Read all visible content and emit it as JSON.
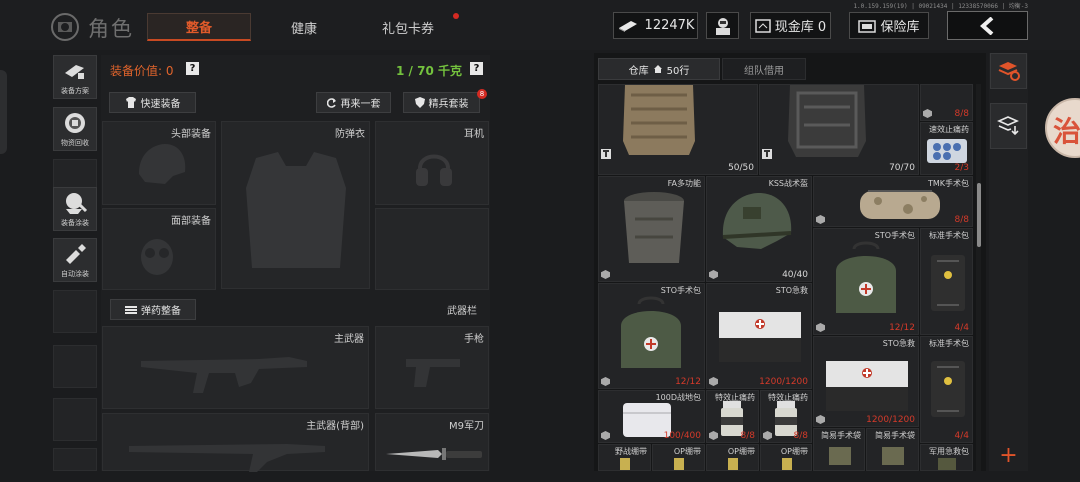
{
  "header": {
    "version": "1.0.159.159(19) | 09021434 | 12338570066 | 均衡-3",
    "title": "角色",
    "tabs": [
      {
        "label": "整备",
        "active": true
      },
      {
        "label": "健康",
        "active": false
      },
      {
        "label": "礼包卡券",
        "active": false,
        "dot": true
      }
    ],
    "currency": "12247K",
    "cash_vault": "现金库 0",
    "safe_vault": "保险库"
  },
  "left_rail": [
    {
      "label": "装备方案",
      "icon": "loadout-icon"
    },
    {
      "label": "物资回收",
      "icon": "recycle-icon"
    },
    {
      "label": "装备涂装",
      "icon": "skin-icon"
    },
    {
      "label": "自动涂装",
      "icon": "auto-paint-icon"
    }
  ],
  "equipment": {
    "value_label": "装备价值: 0",
    "help": "?",
    "weight": "1 / 70 千克",
    "quick_equip": "快速装备",
    "again": "再来一套",
    "elite": "精兵套装",
    "elite_badge": "8",
    "slots": {
      "head": "头部装备",
      "armor": "防弹衣",
      "ear": "耳机",
      "face": "面部装备",
      "primary": "主武器",
      "pistol": "手枪",
      "back": "主武器(背部)",
      "knife": "M9军刀"
    },
    "ammo_btn": "弹药整备",
    "weapon_bar": "武器栏"
  },
  "storage": {
    "tab_warehouse": "仓库",
    "rows": "50行",
    "tab_team": "组队借用",
    "items": [
      {
        "name": "",
        "count": "50/50",
        "count_color": "white"
      },
      {
        "name": "",
        "count": "70/70",
        "count_color": "white"
      },
      {
        "name": "",
        "count": "8/8",
        "count_color": "red"
      },
      {
        "name": "速效止痛药",
        "count": "2/3",
        "count_color": "red"
      },
      {
        "name": "FA多功能",
        "count": "",
        "count_color": "red"
      },
      {
        "name": "KSS战术盔",
        "count": "40/40",
        "count_color": "white"
      },
      {
        "name": "TMK手术包",
        "count": "8/8",
        "count_color": "red"
      },
      {
        "name": "STO手术包",
        "count": "12/12",
        "count_color": "red"
      },
      {
        "name": "标准手术包",
        "count": "4/4",
        "count_color": "red"
      },
      {
        "name": "STO手术包",
        "count": "12/12",
        "count_color": "red"
      },
      {
        "name": "STO急救",
        "count": "1200/1200",
        "count_color": "red"
      },
      {
        "name": "STO急救",
        "count": "1200/1200",
        "count_color": "red"
      },
      {
        "name": "标准手术包",
        "count": "4/4",
        "count_color": "red"
      },
      {
        "name": "100D战地包",
        "count": "100/400",
        "count_color": "red"
      },
      {
        "name": "特效止痛药",
        "count": "8/8",
        "count_color": "red"
      },
      {
        "name": "特效止痛药",
        "count": "8/8",
        "count_color": "red"
      },
      {
        "name": "野战绷带",
        "count": "",
        "count_color": "red"
      },
      {
        "name": "OP绷带",
        "count": "",
        "count_color": "red"
      },
      {
        "name": "OP绷带",
        "count": "",
        "count_color": "red"
      },
      {
        "name": "OP绷带",
        "count": "",
        "count_color": "red"
      },
      {
        "name": "简易手术袋",
        "count": "",
        "count_color": "red"
      },
      {
        "name": "简易手术袋",
        "count": "",
        "count_color": "red"
      },
      {
        "name": "军用急救包",
        "count": "",
        "count_color": "red"
      }
    ]
  },
  "right_rail": {
    "add": "+"
  },
  "side_float": "治",
  "colors": {
    "accent": "#e05a2a",
    "weight_green": "#74c23e",
    "count_red": "#d43a2a"
  }
}
